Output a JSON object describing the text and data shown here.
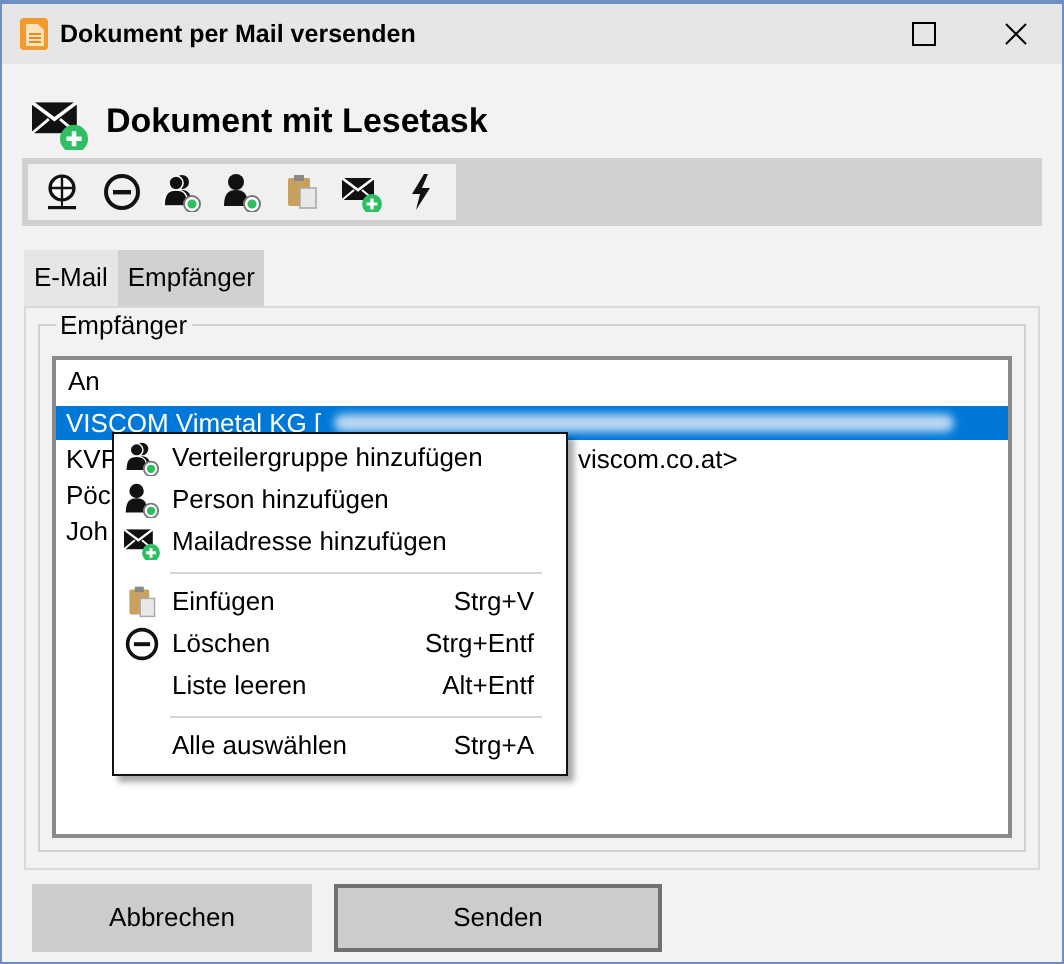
{
  "window": {
    "title": "Dokument per Mail versenden"
  },
  "header": {
    "title": "Dokument mit Lesetask"
  },
  "tabs": [
    {
      "label": "E-Mail",
      "selected": false
    },
    {
      "label": "Empfänger",
      "selected": true
    }
  ],
  "recipients": {
    "legend": "Empfänger",
    "column": "An",
    "rows": [
      {
        "name": "VISCOM Vimetal KG [",
        "selected": true,
        "redacted": true
      },
      {
        "name": "KVP",
        "tail": "viscom.co.at>",
        "selected": false,
        "redacted": false
      },
      {
        "name": "Pöc",
        "selected": false,
        "redacted": false
      },
      {
        "name": "Joh",
        "selected": false,
        "redacted": false
      }
    ]
  },
  "context_menu": [
    {
      "kind": "item",
      "label": "Verteilergruppe hinzufügen"
    },
    {
      "kind": "item",
      "label": "Person hinzufügen"
    },
    {
      "kind": "item",
      "label": "Mailadresse hinzufügen"
    },
    {
      "kind": "separator"
    },
    {
      "kind": "item",
      "label": "Einfügen",
      "shortcut": "Strg+V"
    },
    {
      "kind": "item",
      "label": "Löschen",
      "shortcut": "Strg+Entf"
    },
    {
      "kind": "item",
      "label": "Liste leeren",
      "shortcut": "Alt+Entf"
    },
    {
      "kind": "separator"
    },
    {
      "kind": "item",
      "label": "Alle auswählen",
      "shortcut": "Strg+A"
    }
  ],
  "buttons": [
    {
      "label": "Abbrechen",
      "default": false
    },
    {
      "label": "Senden",
      "default": true
    }
  ]
}
